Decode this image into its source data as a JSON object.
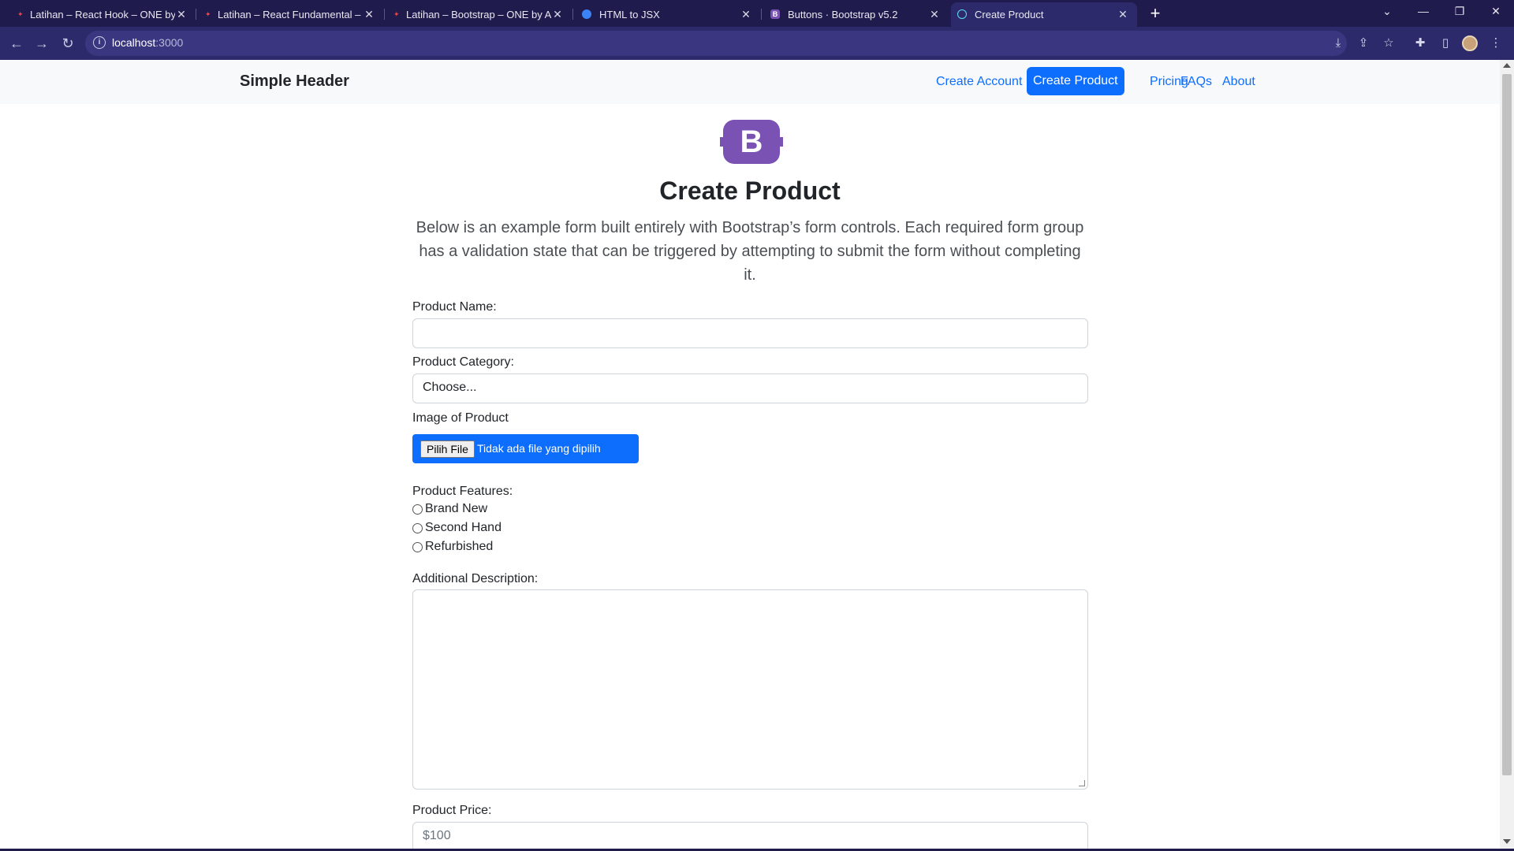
{
  "browser": {
    "tabs": [
      {
        "title": "Latihan – React Hook – ONE by A"
      },
      {
        "title": "Latihan – React Fundamental – O"
      },
      {
        "title": "Latihan – Bootstrap – ONE by Alt"
      },
      {
        "title": "HTML to JSX"
      },
      {
        "title": "Buttons · Bootstrap v5.2"
      },
      {
        "title": "Create Product"
      }
    ],
    "new_tab": "+",
    "url_host": "localhost",
    "url_port": ":3000",
    "colors": {
      "tab_bar": "#1f1b4d",
      "toolbar": "#2d2a6b"
    }
  },
  "site": {
    "brand": "Simple Header",
    "nav": [
      {
        "label": "Create Account",
        "active": false
      },
      {
        "label": "Create Product",
        "active": true
      },
      {
        "label": "Pricing",
        "active": false
      },
      {
        "label": "FAQs",
        "active": false
      },
      {
        "label": "About",
        "active": false
      }
    ],
    "logo_letter": "B",
    "colors": {
      "primary": "#0d6efd",
      "logo": "#7952b3"
    }
  },
  "form": {
    "title": "Create Product",
    "lead": "Below is an example form built entirely with Bootstrap’s form controls. Each required form group has a validation state that can be triggered by attempting to submit the form without completing it.",
    "product_name": {
      "label": "Product Name:",
      "value": ""
    },
    "product_category": {
      "label": "Product Category:",
      "selected": "Choose..."
    },
    "image": {
      "label": "Image of Product",
      "button": "Pilih File",
      "status": "Tidak ada file yang dipilih"
    },
    "features": {
      "label": "Product Features:",
      "options": [
        "Brand New",
        "Second Hand",
        "Refurbished"
      ]
    },
    "description": {
      "label": "Additional Description:",
      "value": ""
    },
    "price": {
      "label": "Product Price:",
      "placeholder": "$100"
    }
  }
}
